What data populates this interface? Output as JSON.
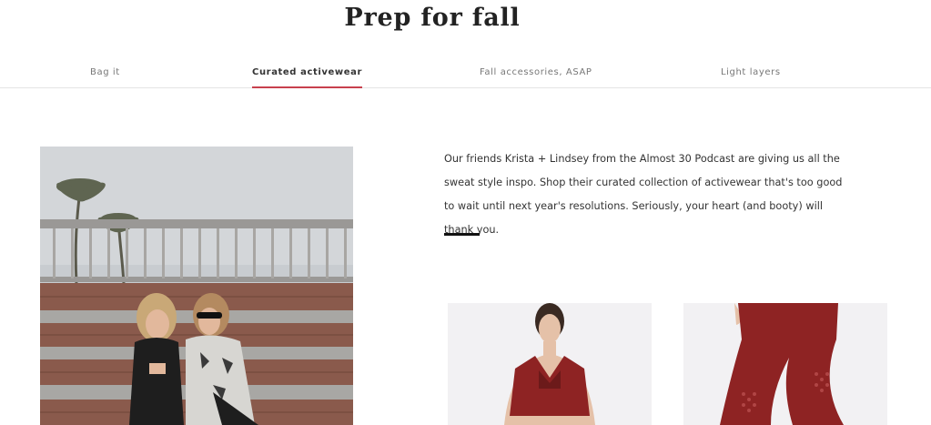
{
  "page": {
    "title": "Prep for fall"
  },
  "tabs": [
    {
      "label": "Bag it",
      "active": false
    },
    {
      "label": "Curated activewear",
      "active": true
    },
    {
      "label": "Fall accessories, ASAP",
      "active": false
    },
    {
      "label": "Light layers",
      "active": false
    }
  ],
  "content": {
    "description": "Our friends Krista + Lindsey from the Almost 30 Podcast are giving us all the sweat style inspo. Shop their curated collection of activewear that's too good to wait until next year's resolutions. Seriously, your heart (and booty) will thank you."
  },
  "colors": {
    "accent_underline": "#c8414e",
    "product_red": "#8e2323",
    "divider": "#111111"
  },
  "products": [
    {
      "kind": "sports-bra"
    },
    {
      "kind": "leggings"
    }
  ]
}
